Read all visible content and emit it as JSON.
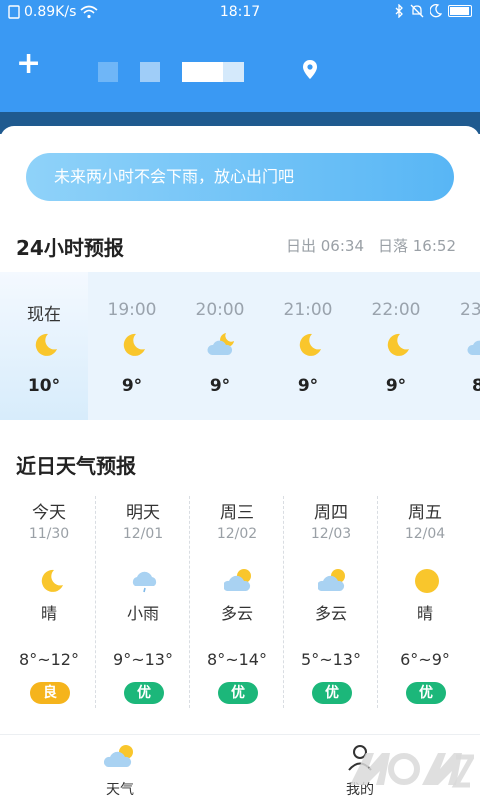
{
  "status_bar": {
    "net_speed": "0.89K/s",
    "time": "18:17",
    "icons": [
      "bluetooth-icon",
      "mute-bell-icon",
      "moon-icon",
      "battery-icon"
    ]
  },
  "header": {
    "add_icon": "plus-icon",
    "location_icon": "location-pin-icon"
  },
  "alert_text": "未来两小时不会下雨，放心出门吧",
  "hourly": {
    "title": "24小时预报",
    "sunrise": "日出 06:34",
    "sunset": "日落 16:52",
    "items": [
      {
        "time": "现在",
        "icon": "moon-icon",
        "temp": "10°"
      },
      {
        "time": "19:00",
        "icon": "moon-icon",
        "temp": "9°"
      },
      {
        "time": "20:00",
        "icon": "cloudy-night-icon",
        "temp": "9°"
      },
      {
        "time": "21:00",
        "icon": "moon-icon",
        "temp": "9°"
      },
      {
        "time": "22:00",
        "icon": "moon-icon",
        "temp": "9°"
      },
      {
        "time": "23",
        "icon": "cloudy-night-icon",
        "temp": "8"
      }
    ]
  },
  "daily": {
    "title": "近日天气预报",
    "items": [
      {
        "day": "今天",
        "date": "11/30",
        "icon": "moon-icon",
        "cond": "晴",
        "range": "8°~12°",
        "aqi": "良",
        "aqi_color": "#f5b41c"
      },
      {
        "day": "明天",
        "date": "12/01",
        "icon": "light-rain-icon",
        "cond": "小雨",
        "range": "9°~13°",
        "aqi": "优",
        "aqi_color": "#1cb77a"
      },
      {
        "day": "周三",
        "date": "12/02",
        "icon": "partly-cloudy-icon",
        "cond": "多云",
        "range": "8°~14°",
        "aqi": "优",
        "aqi_color": "#1cb77a"
      },
      {
        "day": "周四",
        "date": "12/03",
        "icon": "partly-cloudy-icon",
        "cond": "多云",
        "range": "5°~13°",
        "aqi": "优",
        "aqi_color": "#1cb77a"
      },
      {
        "day": "周五",
        "date": "12/04",
        "icon": "sun-icon",
        "cond": "晴",
        "range": "6°~9°",
        "aqi": "优",
        "aqi_color": "#1cb77a"
      }
    ]
  },
  "nav": {
    "weather_label": "天气",
    "mine_label": "我的"
  },
  "colors": {
    "header_blue": "#3a99f3",
    "moon_yellow": "#f9c62c",
    "aqi_good": "#f5b41c",
    "aqi_excellent": "#1cb77a"
  }
}
